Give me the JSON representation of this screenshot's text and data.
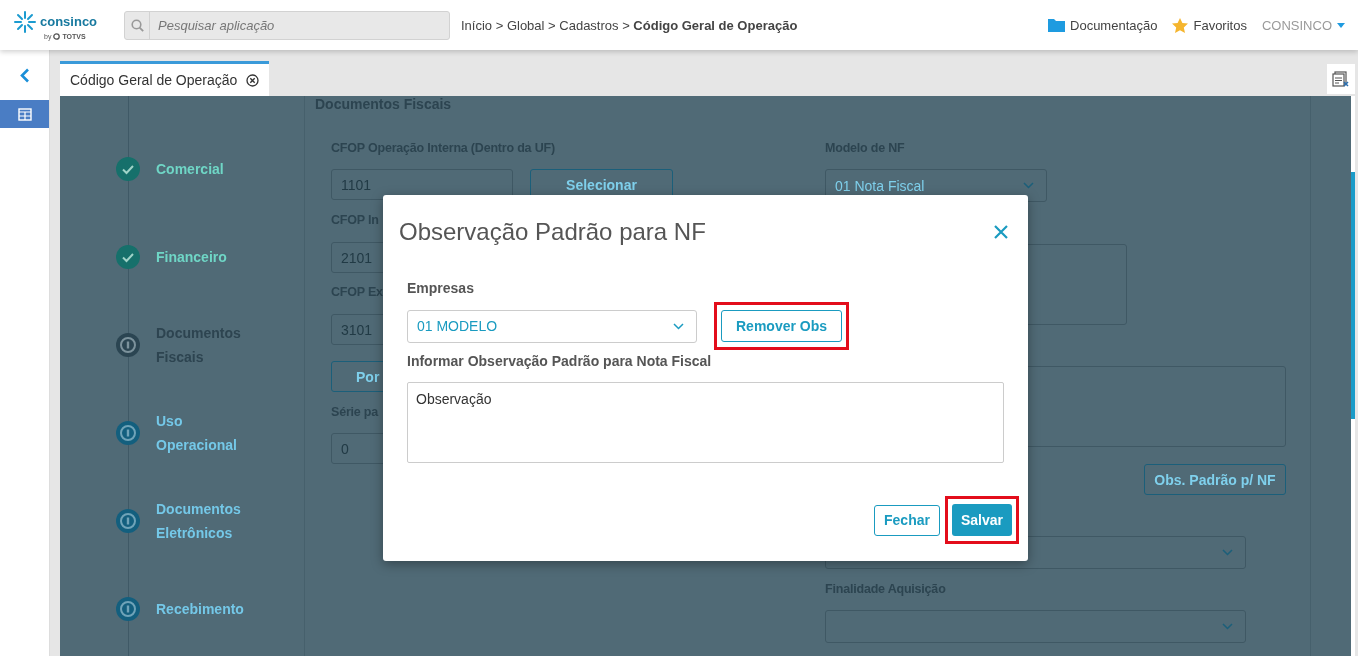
{
  "header": {
    "logo": {
      "name": "consinco",
      "by": "by",
      "brand": "TOTVS"
    },
    "search": {
      "placeholder": "Pesquisar aplicação"
    },
    "breadcrumb": "Início > Global > Cadastros > **Código Geral de Operação**",
    "links": [
      {
        "kind": "folder",
        "label": "Documentação"
      },
      {
        "kind": "star",
        "label": "Favoritos"
      }
    ],
    "user": "CONSINCO"
  },
  "tabs": [
    {
      "label": "Código Geral de Operação",
      "selected": true
    }
  ],
  "steps": [
    {
      "label": "Comercial",
      "completed": true,
      "selected": false
    },
    {
      "label": "Financeiro",
      "completed": true,
      "selected": false
    },
    {
      "label": "Documentos Fiscais",
      "completed": false,
      "selected": true
    },
    {
      "label": "Uso Operacional",
      "completed": false,
      "selected": false
    },
    {
      "label": "Documentos Eletrônicos",
      "completed": false,
      "selected": false
    },
    {
      "label": "Recebimento",
      "completed": false,
      "selected": false
    }
  ],
  "form": {
    "heading": "Documentos Fiscais",
    "left": [
      {
        "kind": "label",
        "text": "CFOP Operação Interna (Dentro da UF)"
      },
      {
        "kind": "field",
        "value": "1101",
        "button": "Selecionar"
      },
      {
        "kind": "label",
        "text": "CFOP In"
      },
      {
        "kind": "field",
        "value": "2101"
      },
      {
        "kind": "label",
        "text": "CFOP Ex"
      },
      {
        "kind": "field",
        "value": "3101"
      },
      {
        "kind": "button",
        "text": "Por"
      },
      {
        "kind": "label",
        "text": "Série pa"
      },
      {
        "kind": "field",
        "value": "0"
      }
    ],
    "right": [
      {
        "kind": "label",
        "text": "Modelo de NF"
      },
      {
        "kind": "select",
        "value": "01 Nota Fiscal"
      },
      {
        "kind": "memo"
      },
      {
        "kind": "wide-memo"
      },
      {
        "kind": "button",
        "text": "Obs. Padrão p/ NF"
      },
      {
        "kind": "select"
      },
      {
        "kind": "label",
        "text": "Finalidade Aquisição"
      },
      {
        "kind": "select"
      }
    ]
  },
  "dialog": {
    "title": "Observação Padrão para NF",
    "company_label": "Empresas",
    "company": "01 MODELO",
    "remove_button": {
      "label": "Remover Obs",
      "highlighted": true
    },
    "note_label": "Informar Observação Padrão para Nota Fiscal",
    "note": "Observação",
    "buttons": [
      {
        "kind": "outline",
        "label": "Fechar",
        "highlighted": false
      },
      {
        "kind": "primary",
        "label": "Salvar",
        "highlighted": true
      }
    ]
  }
}
